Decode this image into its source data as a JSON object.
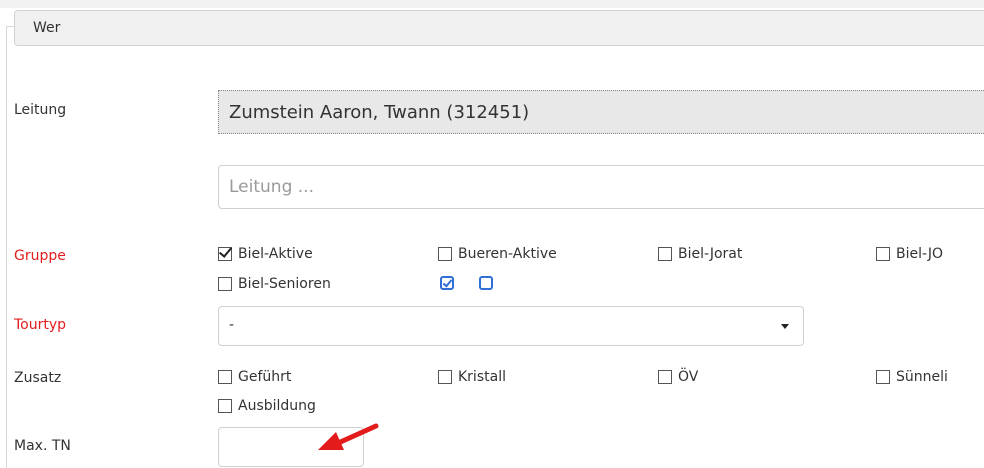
{
  "legend": {
    "title": "Wer"
  },
  "leitung": {
    "label": "Leitung",
    "selected": "Zumstein Aaron, Twann (312451)",
    "placeholder": "Leitung ..."
  },
  "gruppe": {
    "label": "Gruppe",
    "options": [
      {
        "label": "Biel-Aktive",
        "checked": true
      },
      {
        "label": "Bueren-Aktive",
        "checked": false
      },
      {
        "label": "Biel-Jorat",
        "checked": false
      },
      {
        "label": "Biel-JO",
        "checked": false
      },
      {
        "label": "Biel-Senioren",
        "checked": false
      }
    ],
    "action_icons": [
      "check-all-icon",
      "uncheck-all-icon"
    ]
  },
  "tourtyp": {
    "label": "Tourtyp",
    "value": "-"
  },
  "zusatz": {
    "label": "Zusatz",
    "options": [
      {
        "label": "Geführt",
        "checked": false
      },
      {
        "label": "Kristall",
        "checked": false
      },
      {
        "label": "ÖV",
        "checked": false
      },
      {
        "label": "Sünneli",
        "checked": false
      },
      {
        "label": "Ausbildung",
        "checked": false
      }
    ]
  },
  "max_tn": {
    "label": "Max. TN",
    "value": ""
  },
  "colors": {
    "required_label": "#e21d1d",
    "accent": "#2f6fd6",
    "arrow": "#e31b1b"
  }
}
